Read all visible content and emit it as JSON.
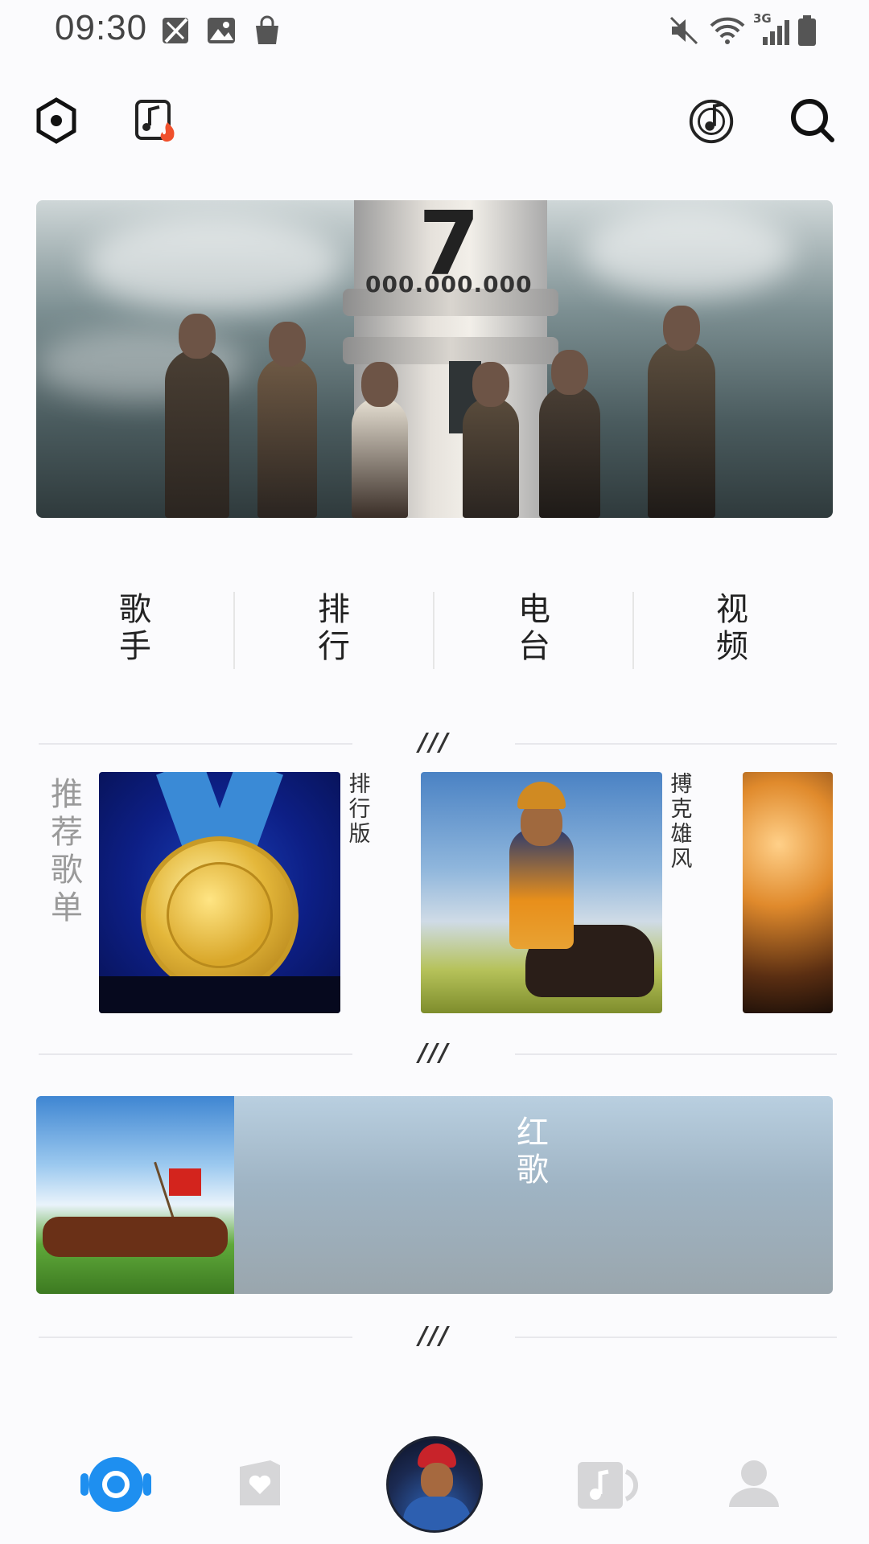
{
  "status_bar": {
    "time": "09:30",
    "icons": [
      "no-sim-icon",
      "gallery-icon",
      "shopping-bag-icon",
      "mute-icon",
      "wifi-icon",
      "signal-3g-icon",
      "battery-icon"
    ],
    "network_label": "3G"
  },
  "toolbar": {
    "left_icons": [
      "hexagon-settings-icon",
      "hot-music-icon"
    ],
    "right_icons": [
      "recognize-music-icon",
      "search-icon"
    ]
  },
  "banner": {
    "tower_number": "7",
    "tower_digits": "000.000.000"
  },
  "categories": [
    {
      "line1": "歌",
      "line2": "手"
    },
    {
      "line1": "排",
      "line2": "行"
    },
    {
      "line1": "电",
      "line2": "台"
    },
    {
      "line1": "视",
      "line2": "频"
    }
  ],
  "separator_mark": "///",
  "recommended": {
    "label": "推荐歌单",
    "cards": [
      {
        "title": "排行版"
      },
      {
        "title": "搏克雄风"
      }
    ]
  },
  "red_song": {
    "title": "红歌"
  },
  "bottom_nav": {
    "accent_color": "#1e8ff0",
    "inactive_color": "#d6d6d8",
    "items": [
      "discover-icon",
      "favorites-icon",
      "now-playing-avatar",
      "music-icon",
      "profile-icon"
    ]
  }
}
